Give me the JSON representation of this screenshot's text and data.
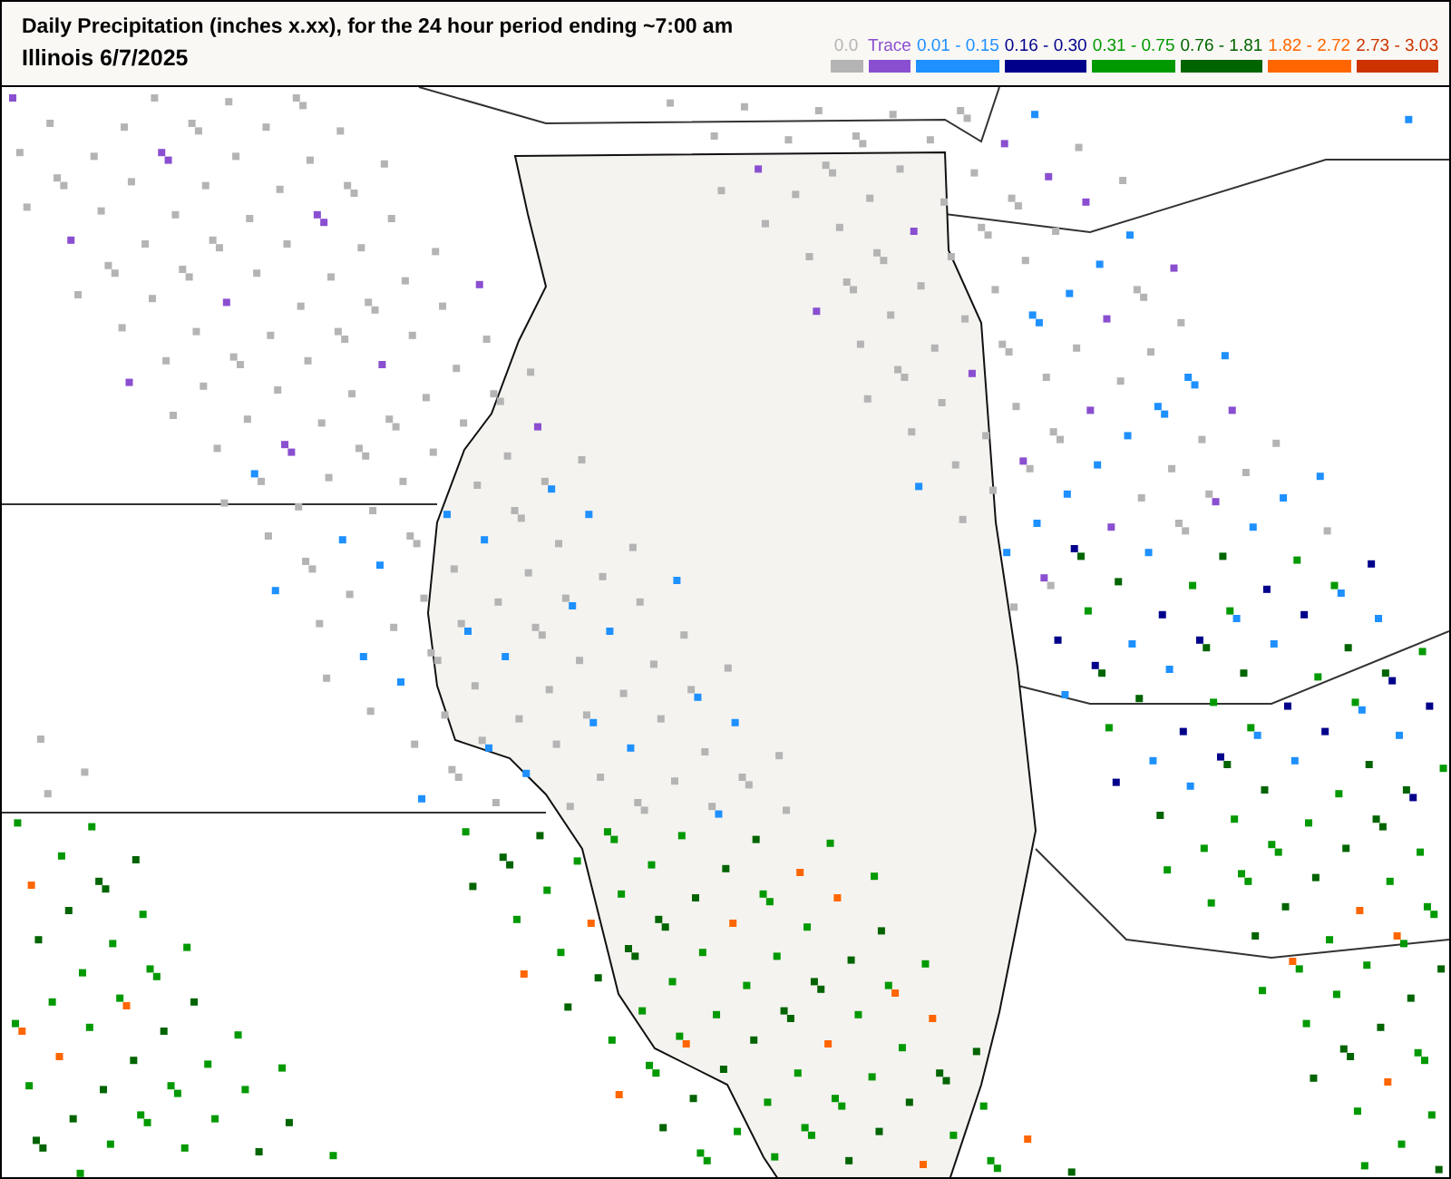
{
  "title": "Daily Precipitation (inches  x.xx),  for the 24 hour period ending ~7:00 am",
  "subtitle": "Illinois 6/7/2025",
  "legend": [
    {
      "label": "0.0",
      "color": "#b4b4b4"
    },
    {
      "label": "Trace",
      "color": "#8a4fd0"
    },
    {
      "label": "0.01 - 0.15",
      "color": "#1e90ff"
    },
    {
      "label": "0.16 - 0.30",
      "color": "#00008b"
    },
    {
      "label": "0.31 - 0.75",
      "color": "#009900"
    },
    {
      "label": "0.76 - 1.81",
      "color": "#006400"
    },
    {
      "label": "1.82 - 2.72",
      "color": "#ff6600"
    },
    {
      "label": "2.73 - 3.03",
      "color": "#cc3300"
    }
  ]
}
